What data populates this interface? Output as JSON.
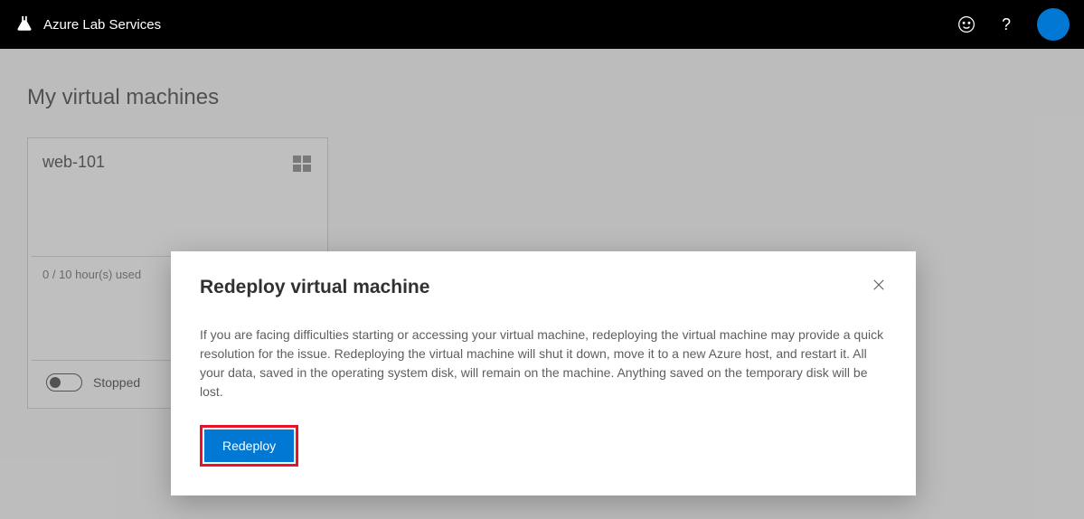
{
  "header": {
    "brand_name": "Azure Lab Services",
    "feedback_icon": "feedback-smiley-icon",
    "help_label": "?"
  },
  "page": {
    "title": "My virtual machines"
  },
  "vm_card": {
    "name": "web-101",
    "os_icon": "windows-icon",
    "hours_text": "0 / 10 hour(s) used",
    "status": "Stopped"
  },
  "dialog": {
    "title": "Redeploy virtual machine",
    "body": "If you are facing difficulties starting or accessing your virtual machine, redeploying the virtual machine may provide a quick resolution for the issue. Redeploying the virtual machine will shut it down, move it to a new Azure host, and restart it. All your data, saved in the operating system disk, will remain on the machine. Anything saved on the temporary disk will be lost.",
    "redeploy_label": "Redeploy"
  }
}
